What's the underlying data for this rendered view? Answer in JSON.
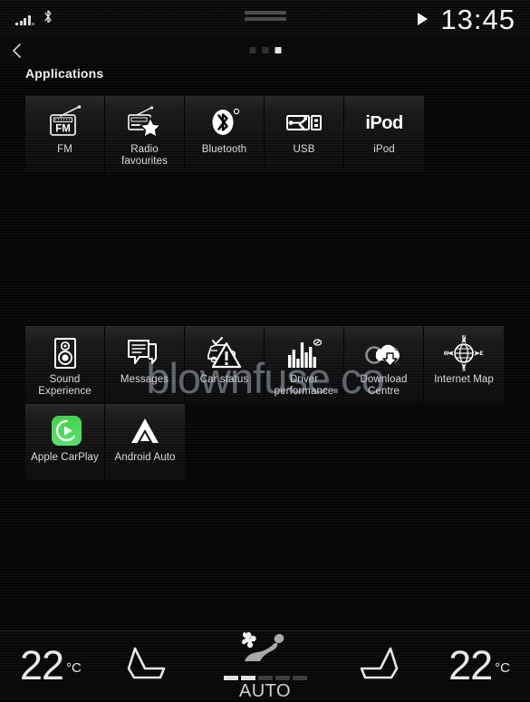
{
  "statusbar": {
    "signal_icon": "signal-bars-icon",
    "bluetooth_icon": "bluetooth-icon",
    "drag_handle": "drag-handle",
    "play_icon": "play-icon",
    "clock": "13:45"
  },
  "nav": {
    "back_icon": "back-chevron-icon",
    "page_dots": [
      false,
      false,
      true
    ],
    "title": "Applications"
  },
  "watermark": {
    "text": "blownfuse.co"
  },
  "rows": [
    {
      "id": "row1",
      "tiles": [
        {
          "label": "FM",
          "icon": "radio-fm-icon"
        },
        {
          "label": "Radio favourites",
          "icon": "radio-favourites-icon"
        },
        {
          "label": "Bluetooth",
          "icon": "bluetooth-icon"
        },
        {
          "label": "USB",
          "icon": "usb-icon"
        },
        {
          "label": "iPod",
          "icon": "ipod-wordmark-icon"
        }
      ]
    },
    {
      "id": "row2",
      "tiles": [
        {
          "label": "Sound Experience",
          "icon": "speaker-icon"
        },
        {
          "label": "Messages",
          "icon": "message-bubble-icon"
        },
        {
          "label": "Car status",
          "icon": "car-status-warning-icon"
        },
        {
          "label": "Driver performance",
          "icon": "bar-chart-icon"
        },
        {
          "label": "Download Centre",
          "icon": "cloud-download-icon"
        },
        {
          "label": "Internet Map",
          "icon": "compass-globe-icon"
        }
      ]
    },
    {
      "id": "row3",
      "tiles": [
        {
          "label": "Apple CarPlay",
          "icon": "apple-carplay-icon"
        },
        {
          "label": "Android Auto",
          "icon": "android-auto-icon"
        }
      ]
    }
  ],
  "climate": {
    "left_temp": "22",
    "left_unit": "°C",
    "left_seat_icon": "seat-icon-left",
    "fan_icon": "fan-seat-icon",
    "fan_level": 2,
    "fan_level_max": 5,
    "auto_label": "AUTO",
    "right_seat_icon": "seat-icon-right",
    "right_temp": "22",
    "right_unit": "°C"
  },
  "colors": {
    "accent_carplay": "#3fd24a",
    "background": "#050505",
    "tile": "#1a1a1a",
    "text": "#e8e8e8",
    "watermark": "#b0bacd"
  }
}
